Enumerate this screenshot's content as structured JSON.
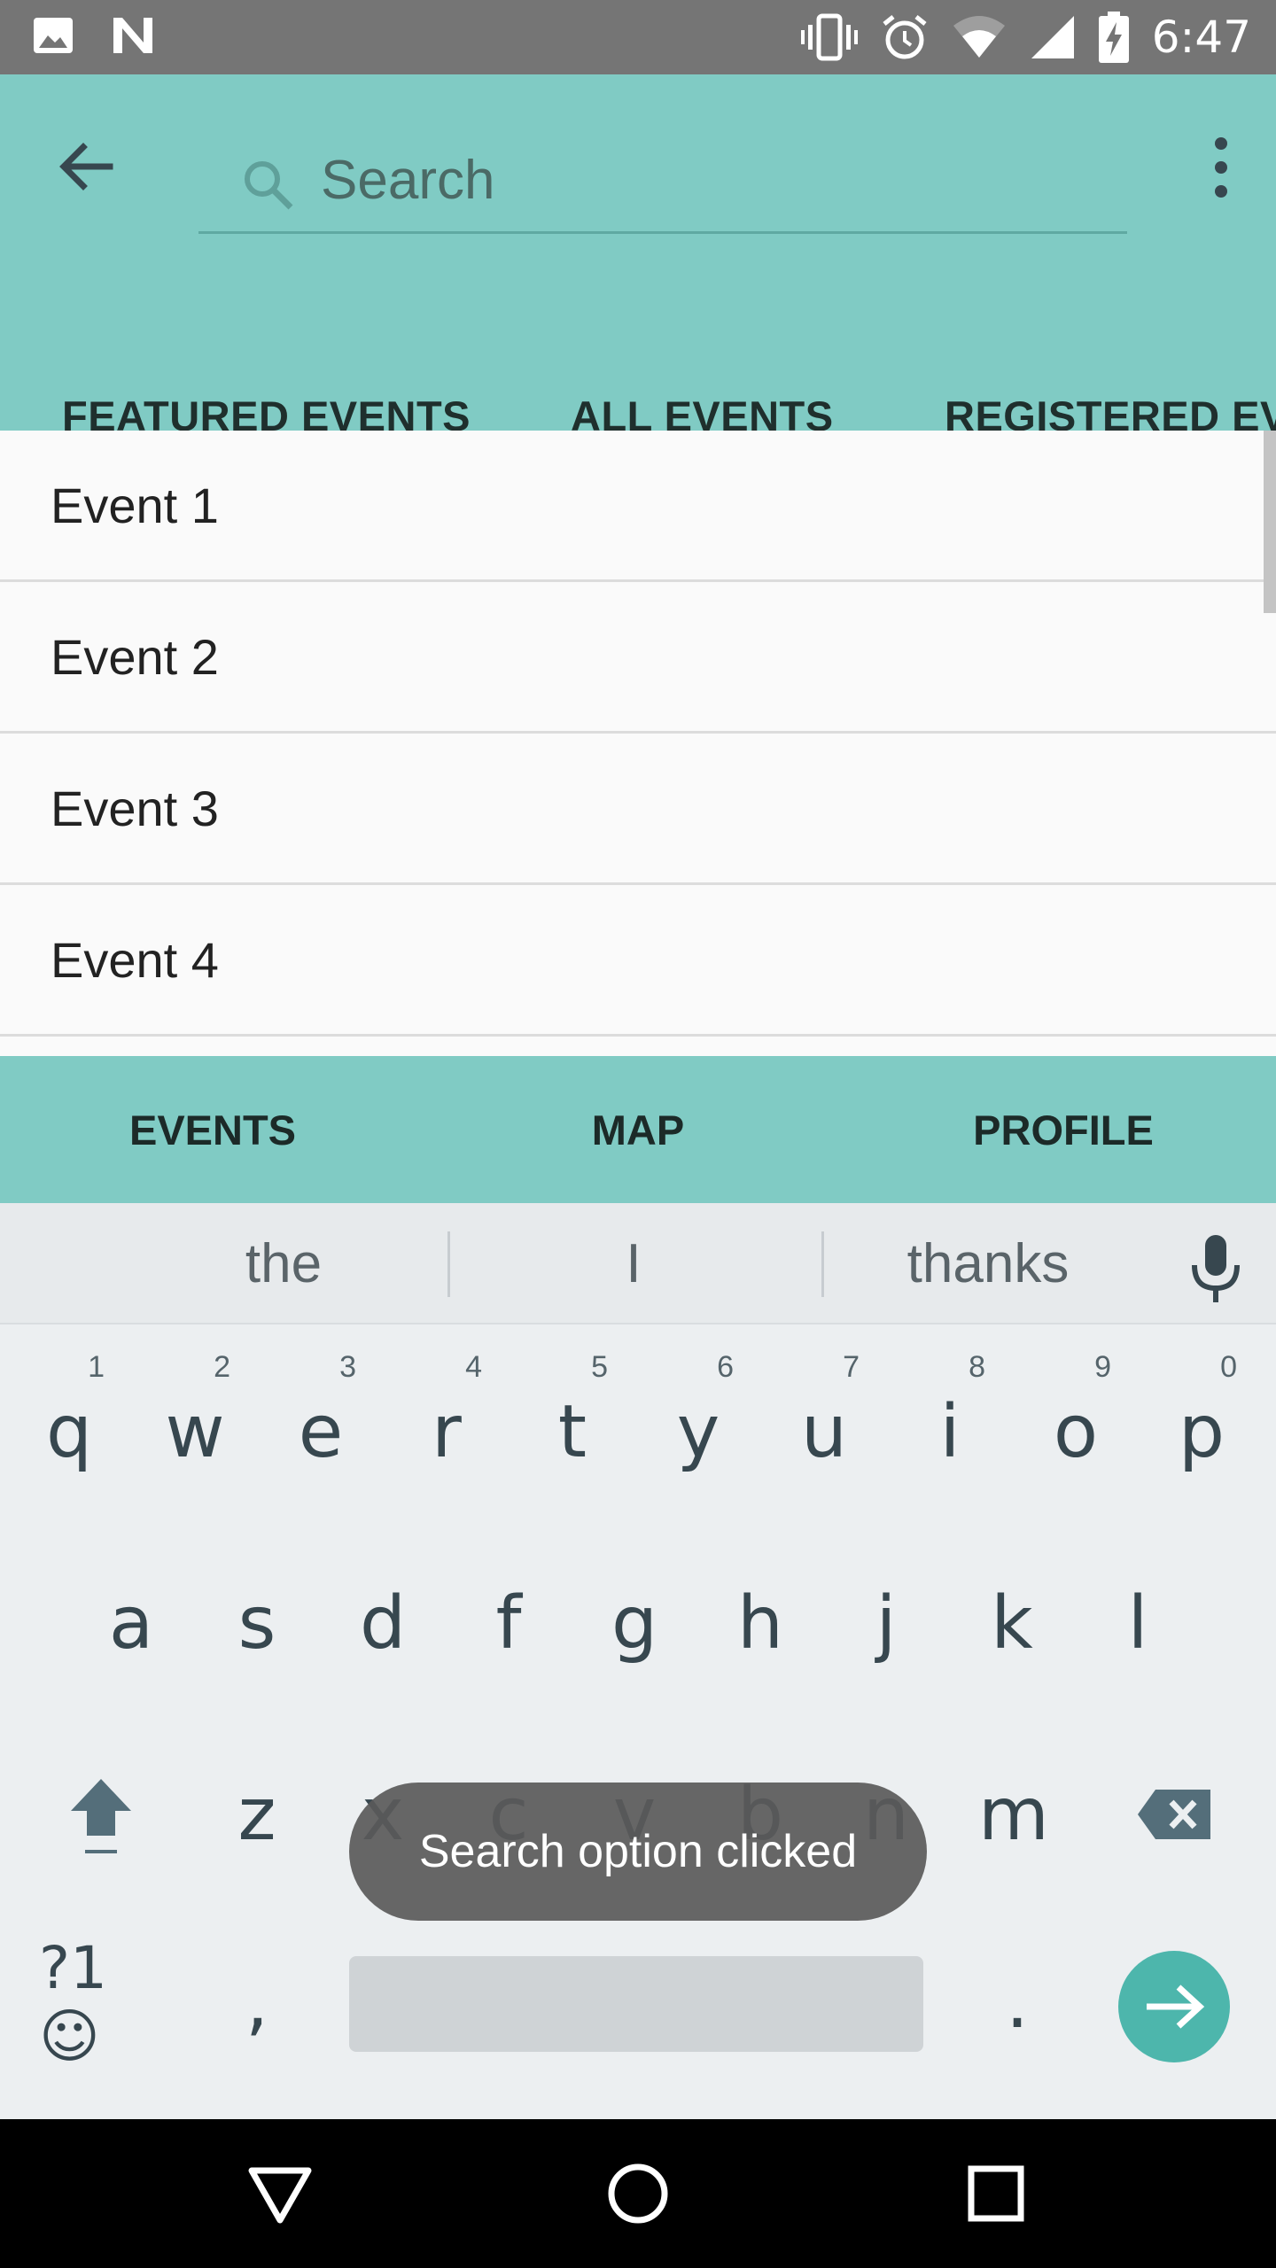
{
  "status_bar": {
    "time": "6:47",
    "left_icons": [
      "image-icon",
      "n-notification-icon"
    ],
    "right_icons": [
      "vibrate-icon",
      "alarm-icon",
      "wifi-icon",
      "signal-icon",
      "battery-charging-icon"
    ]
  },
  "app_bar": {
    "search_placeholder": "Search",
    "tabs": [
      {
        "label": "FEATURED EVENTS"
      },
      {
        "label": "ALL EVENTS"
      },
      {
        "label": "REGISTERED EVE"
      }
    ]
  },
  "events": [
    {
      "label": "Event 1"
    },
    {
      "label": "Event 2"
    },
    {
      "label": "Event 3"
    },
    {
      "label": "Event 4"
    }
  ],
  "bottom_nav": [
    {
      "label": "EVENTS"
    },
    {
      "label": "MAP"
    },
    {
      "label": "PROFILE"
    }
  ],
  "keyboard": {
    "suggestions": [
      "the",
      "I",
      "thanks"
    ],
    "row1": [
      {
        "key": "q",
        "hint": "1"
      },
      {
        "key": "w",
        "hint": "2"
      },
      {
        "key": "e",
        "hint": "3"
      },
      {
        "key": "r",
        "hint": "4"
      },
      {
        "key": "t",
        "hint": "5"
      },
      {
        "key": "y",
        "hint": "6"
      },
      {
        "key": "u",
        "hint": "7"
      },
      {
        "key": "i",
        "hint": "8"
      },
      {
        "key": "o",
        "hint": "9"
      },
      {
        "key": "p",
        "hint": "0"
      }
    ],
    "row2": [
      "a",
      "s",
      "d",
      "f",
      "g",
      "h",
      "j",
      "k",
      "l"
    ],
    "row3": [
      "z",
      "x",
      "c",
      "v",
      "b",
      "n",
      "m"
    ],
    "symbols_label": "?1☺",
    "comma": ",",
    "period": "."
  },
  "toast": {
    "message": "Search option clicked"
  },
  "colors": {
    "app_bar": "#80cbc4",
    "accent": "#4db6ac",
    "status_bar": "#757575"
  }
}
